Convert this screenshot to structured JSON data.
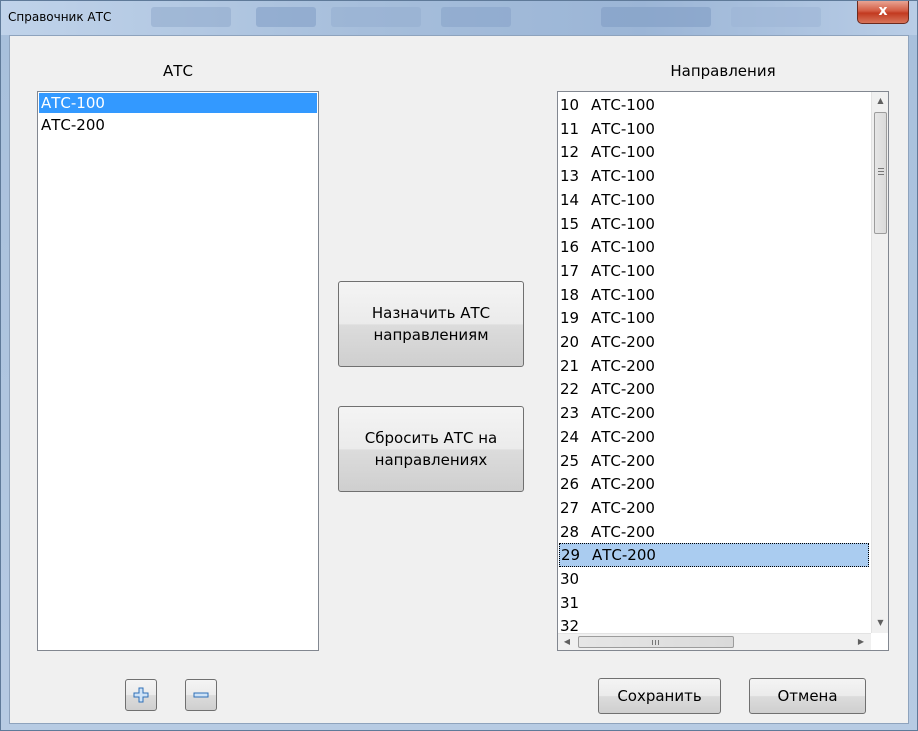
{
  "window": {
    "title": "Справочник АТС",
    "close_glyph": "x"
  },
  "left_panel": {
    "header": "АТС",
    "items": [
      {
        "label": "АТС-100",
        "selected": true
      },
      {
        "label": "АТС-200",
        "selected": false
      }
    ],
    "add_icon": "plus-icon",
    "remove_icon": "minus-icon"
  },
  "actions": {
    "assign_line1": "Назначить АТС",
    "assign_line2": "направлениям",
    "reset_line1": "Сбросить АТС на",
    "reset_line2": "направлениях"
  },
  "right_panel": {
    "header": "Направления",
    "items": [
      {
        "num": "10",
        "ats": "АТС-100"
      },
      {
        "num": "11",
        "ats": "АТС-100"
      },
      {
        "num": "12",
        "ats": "АТС-100"
      },
      {
        "num": "13",
        "ats": "АТС-100"
      },
      {
        "num": "14",
        "ats": "АТС-100"
      },
      {
        "num": "15",
        "ats": "АТС-100"
      },
      {
        "num": "16",
        "ats": "АТС-100"
      },
      {
        "num": "17",
        "ats": "АТС-100"
      },
      {
        "num": "18",
        "ats": "АТС-100"
      },
      {
        "num": "19",
        "ats": "АТС-100"
      },
      {
        "num": "20",
        "ats": "АТС-200"
      },
      {
        "num": "21",
        "ats": "АТС-200"
      },
      {
        "num": "22",
        "ats": "АТС-200"
      },
      {
        "num": "23",
        "ats": "АТС-200"
      },
      {
        "num": "24",
        "ats": "АТС-200"
      },
      {
        "num": "25",
        "ats": "АТС-200"
      },
      {
        "num": "26",
        "ats": "АТС-200"
      },
      {
        "num": "27",
        "ats": "АТС-200"
      },
      {
        "num": "28",
        "ats": "АТС-200"
      },
      {
        "num": "29",
        "ats": "АТС-200",
        "selected": true
      },
      {
        "num": "30",
        "ats": ""
      },
      {
        "num": "31",
        "ats": ""
      },
      {
        "num": "32",
        "ats": ""
      }
    ]
  },
  "footer": {
    "save": "Сохранить",
    "cancel": "Отмена"
  },
  "colors": {
    "selection": "#3399ff",
    "row_selection": "#aaccf0",
    "close": "#c23a20"
  }
}
